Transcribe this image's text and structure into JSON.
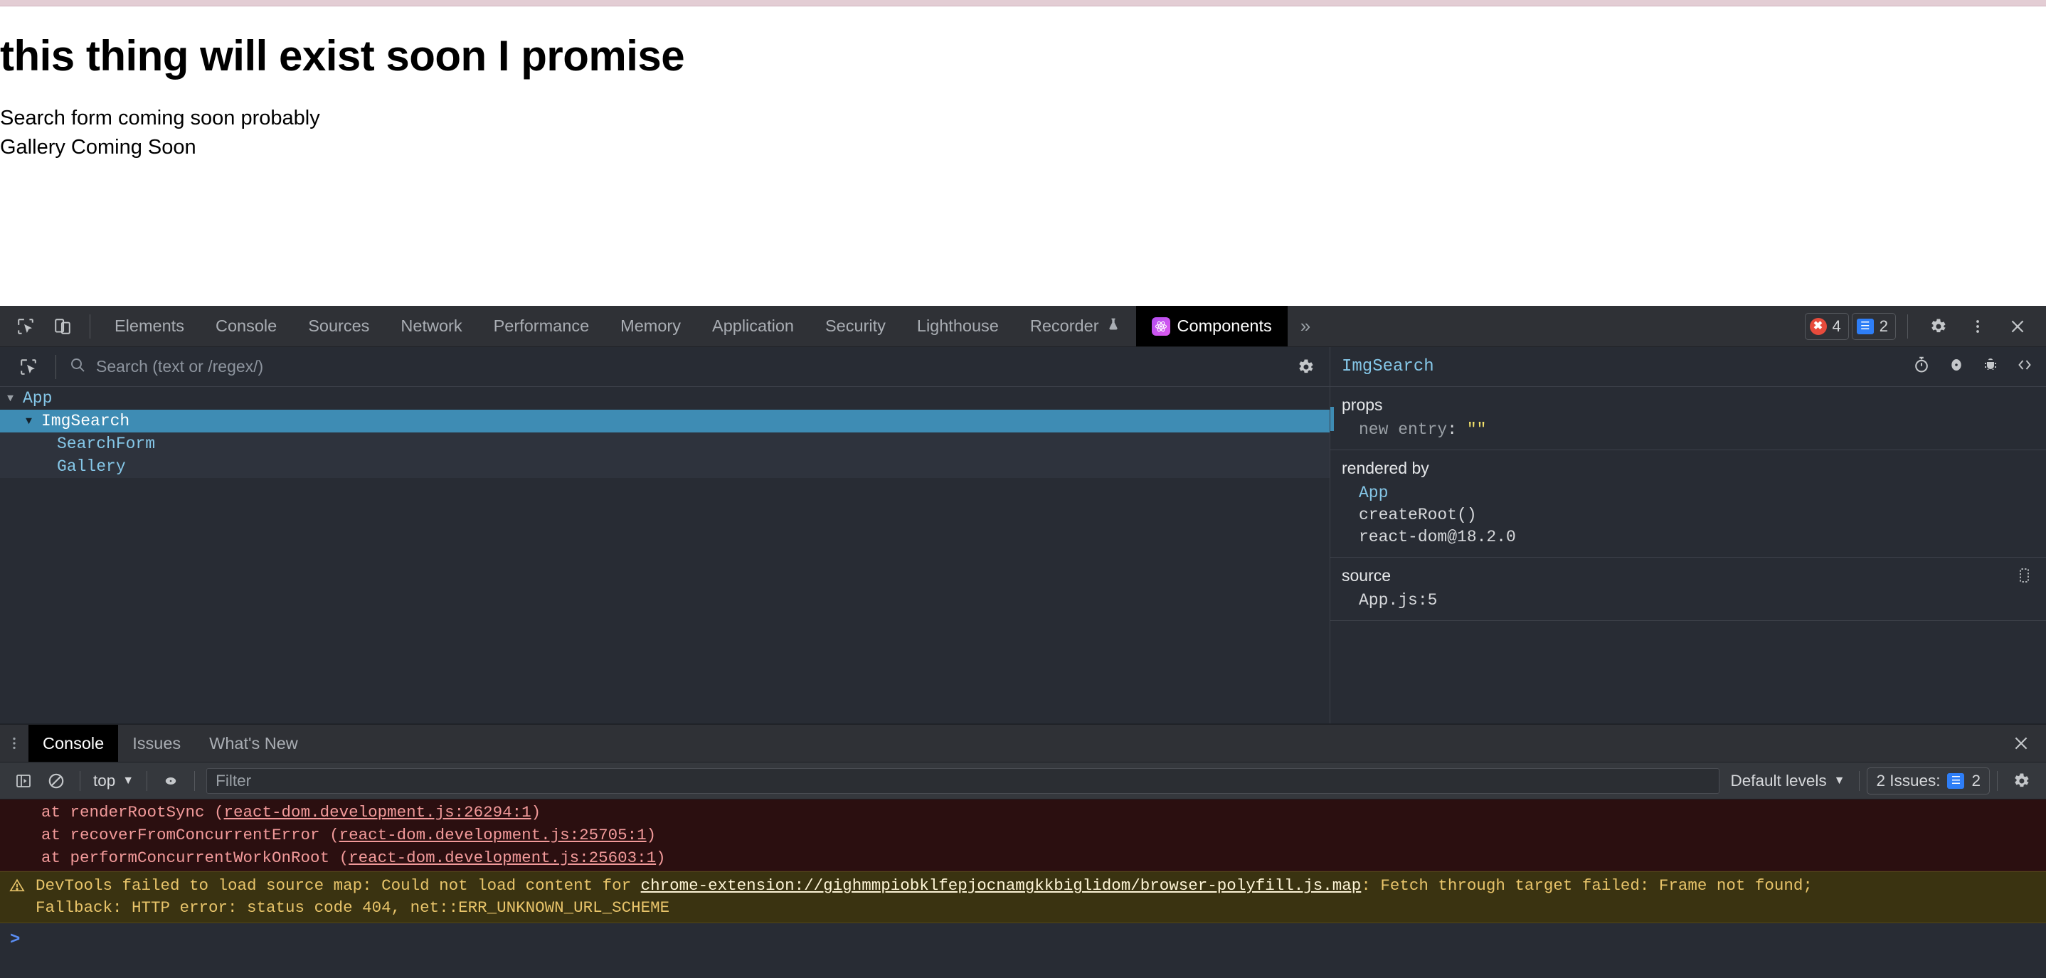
{
  "page": {
    "heading": "this thing will exist soon I promise",
    "line1": "Search form coming soon probably",
    "line2": "Gallery Coming Soon"
  },
  "devtools": {
    "toolbar": {
      "inspect_icon": "inspect-element-icon",
      "device_icon": "device-toolbar-icon",
      "tabs": [
        {
          "label": "Elements",
          "active": false
        },
        {
          "label": "Console",
          "active": false
        },
        {
          "label": "Sources",
          "active": false
        },
        {
          "label": "Network",
          "active": false
        },
        {
          "label": "Performance",
          "active": false
        },
        {
          "label": "Memory",
          "active": false
        },
        {
          "label": "Application",
          "active": false
        },
        {
          "label": "Security",
          "active": false
        },
        {
          "label": "Lighthouse",
          "active": false
        },
        {
          "label": "Recorder",
          "active": false
        },
        {
          "label": "Components",
          "active": true
        }
      ],
      "recorder_flask_icon": "flask-icon",
      "more_tabs_label": "»",
      "error_count": "4",
      "info_count": "2",
      "settings_icon": "gear-icon",
      "menu_icon": "kebab-menu-icon",
      "close_icon": "close-icon"
    },
    "components": {
      "select_element_icon": "select-component-icon",
      "search_icon": "search-icon",
      "search_placeholder": "Search (text or /regex/)",
      "search_value": "",
      "settings_icon": "gear-icon",
      "tree": [
        {
          "label": "App",
          "depth": 0,
          "expanded": true,
          "selected": false
        },
        {
          "label": "ImgSearch",
          "depth": 1,
          "expanded": true,
          "selected": true
        },
        {
          "label": "SearchForm",
          "depth": 2,
          "expanded": null,
          "selected": false
        },
        {
          "label": "Gallery",
          "depth": 2,
          "expanded": null,
          "selected": false
        }
      ],
      "detail": {
        "title": "ImgSearch",
        "icons": [
          "stopwatch-icon",
          "eye-icon",
          "bug-icon",
          "code-brackets-icon"
        ],
        "props": {
          "section_label": "props",
          "rows": [
            {
              "key": "new entry",
              "value": "\"\""
            }
          ]
        },
        "rendered_by": {
          "section_label": "rendered by",
          "rows": [
            {
              "text": "App",
              "type": "component"
            },
            {
              "text": "createRoot()",
              "type": "plain"
            },
            {
              "text": "react-dom@18.2.0",
              "type": "plain"
            }
          ]
        },
        "source": {
          "section_label": "source",
          "copy_icon": "copy-source-icon",
          "rows": [
            {
              "text": "App.js:5"
            }
          ]
        }
      }
    },
    "drawer": {
      "menu_icon": "kebab-menu-icon",
      "tabs": [
        {
          "label": "Console",
          "active": true
        },
        {
          "label": "Issues",
          "active": false
        },
        {
          "label": "What's New",
          "active": false
        }
      ],
      "close_icon": "close-icon",
      "console_toolbar": {
        "sidebar_icon": "console-sidebar-icon",
        "clear_icon": "clear-console-icon",
        "context_label": "top",
        "eye_icon": "live-expression-icon",
        "filter_placeholder": "Filter",
        "filter_value": "",
        "levels_label": "Default levels",
        "issues_label": "2 Issues:",
        "issues_count": "2",
        "settings_icon": "gear-icon"
      },
      "messages": [
        {
          "type": "error",
          "lines": [
            {
              "prefix": "at renderRootSync (",
              "link": "react-dom.development.js:26294:1",
              "suffix": ")"
            },
            {
              "prefix": "at recoverFromConcurrentError (",
              "link": "react-dom.development.js:25705:1",
              "suffix": ")"
            },
            {
              "prefix": "at performConcurrentWorkOnRoot (",
              "link": "react-dom.development.js:25603:1",
              "suffix": ")"
            }
          ]
        },
        {
          "type": "warning",
          "icon": "warning-triangle-icon",
          "line1_prefix": "DevTools failed to load source map: Could not load content for ",
          "line1_link": "chrome-extension://gighmmpiobklfepjocnamgkkbiglidom/browser-polyfill.js.map",
          "line1_suffix": ": Fetch through target failed: Frame not found;",
          "line2": "Fallback: HTTP error: status code 404, net::ERR_UNKNOWN_URL_SCHEME"
        }
      ],
      "prompt_caret": ">",
      "prompt_value": ""
    }
  },
  "colors": {
    "page_top_strip": "#e3cdd4",
    "devtools_bg": "#282c34",
    "toolbar_bg": "#2f3136",
    "active_tab_bg": "#000000",
    "tree_selected": "#3e8cb4",
    "component_name": "#85c7e8",
    "string_value": "#f2e06a",
    "error_bg": "#2b0f10",
    "error_text": "#f29a9a",
    "warning_bg": "#3a3311",
    "warning_text": "#e8c46a",
    "react_accent": "#b24cf0",
    "badge_error": "#e74b3c",
    "badge_info": "#2e7ef7",
    "prompt_caret": "#5b8ef4"
  }
}
